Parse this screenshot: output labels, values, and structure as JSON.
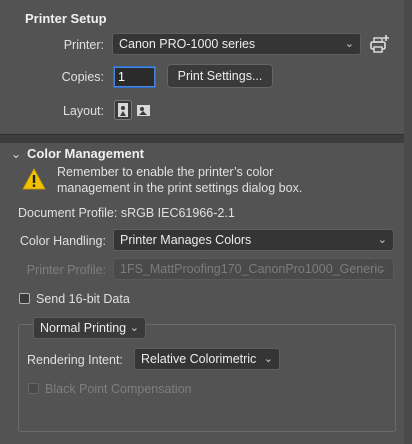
{
  "printer_setup": {
    "title": "Printer Setup",
    "printer_label": "Printer:",
    "printer_value": "Canon PRO-1000 series",
    "copies_label": "Copies:",
    "copies_value": "1",
    "print_settings_button": "Print Settings...",
    "layout_label": "Layout:"
  },
  "color_management": {
    "title": "Color Management",
    "warning_text_line1": "Remember to enable the printer’s color",
    "warning_text_line2": "management in the print settings dialog box.",
    "document_profile": "Document Profile: sRGB IEC61966-2.1",
    "color_handling_label": "Color Handling:",
    "color_handling_value": "Printer Manages Colors",
    "printer_profile_label": "Printer Profile:",
    "printer_profile_value": "1FS_MattProofing170_CanonPro1000_Generic",
    "send16bit_label": "Send 16-bit Data",
    "send16bit_checked": false,
    "normal_printing_value": "Normal Printing",
    "rendering_intent_label": "Rendering Intent:",
    "rendering_intent_value": "Relative Colorimetric",
    "black_point_label": "Black Point Compensation",
    "black_point_checked": false
  },
  "colors": {
    "panel_bg": "#535353",
    "warning_yellow": "#f2c200",
    "focus_blue": "#2f6fcf"
  },
  "icons": [
    "printer-add-icon",
    "portrait-layout-icon",
    "landscape-layout-icon",
    "chevron-down-icon",
    "warning-icon"
  ]
}
